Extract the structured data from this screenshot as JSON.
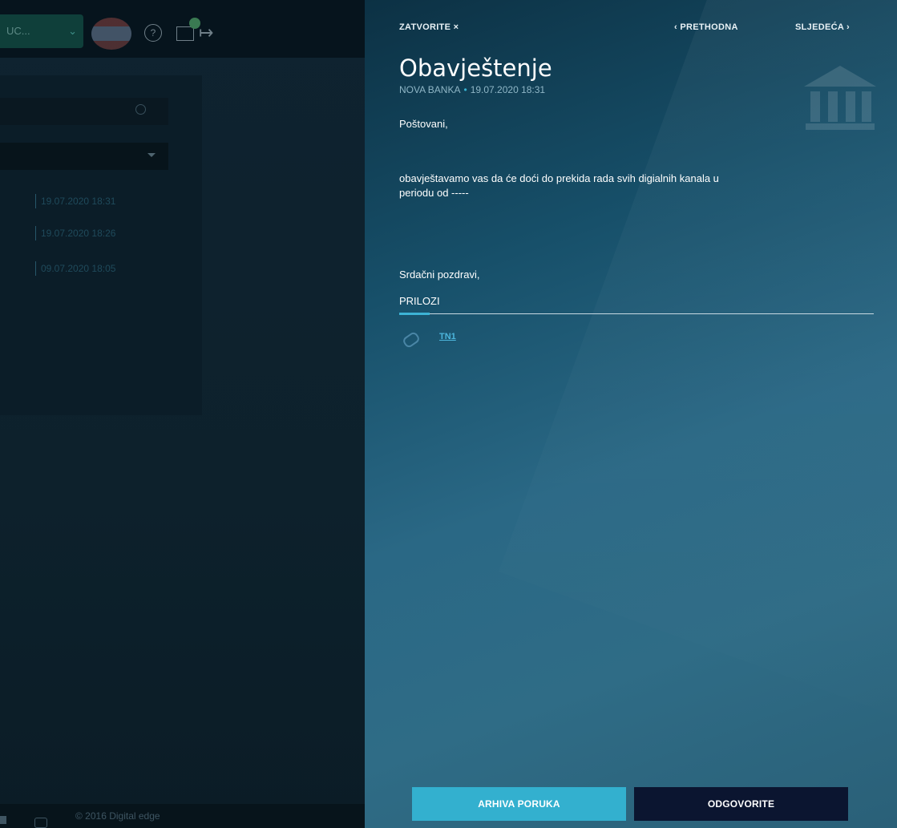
{
  "background": {
    "account_select": {
      "value": "UC..."
    },
    "icons": [
      "flag-icon",
      "help-icon",
      "messages-icon",
      "logout-icon"
    ],
    "message_dates": [
      "19.07.2020 18:31",
      "19.07.2020 18:26",
      "09.07.2020 18:05"
    ],
    "footer": {
      "copyright": "© 2016 Digital edge"
    }
  },
  "drawer": {
    "nav": {
      "close": "ZATVORITE ×",
      "prev": "‹ PRETHODNA",
      "next": "SLJEDEĆA ›"
    },
    "title": "Obavještenje",
    "sender": "NOVA BANKA",
    "date": "19.07.2020 18:31",
    "body": {
      "greeting": "Poštovani,",
      "paragraph_line1": "obavještavamo vas da će doći do prekida rada svih digialnih kanala u",
      "paragraph_line2": "periodu od -----",
      "closing": "Srdačni pozdravi,"
    },
    "attachments": {
      "title": "PRILOZI",
      "items": [
        "TN1"
      ]
    },
    "buttons": {
      "archive": "ARHIVA PORUKA",
      "reply": "ODGOVORITE"
    }
  },
  "colors": {
    "accent": "#33b0cf",
    "reply_button": "#0b1530",
    "drawer_bg": "#2a6885"
  }
}
